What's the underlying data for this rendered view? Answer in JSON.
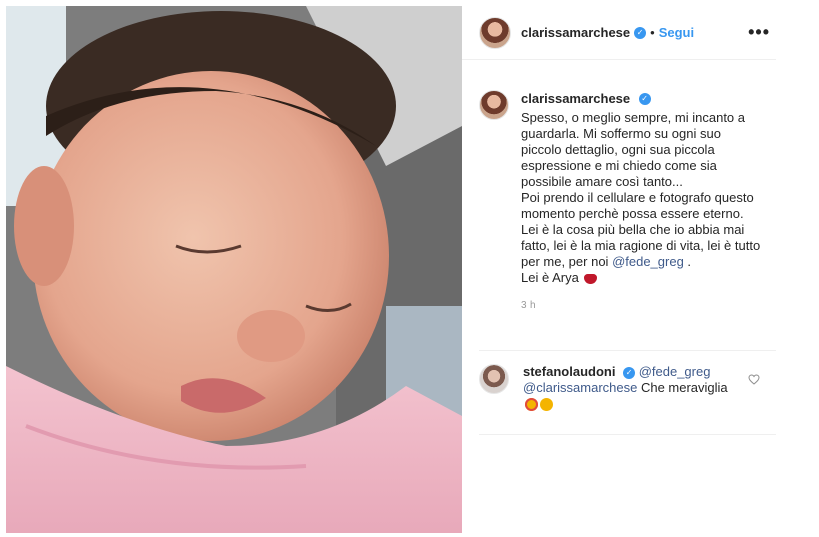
{
  "header": {
    "username": "clarissamarchese",
    "verified_mark": "✓",
    "separator": "•",
    "follow_label": "Segui",
    "more_label": "•••"
  },
  "caption": {
    "username": "clarissamarchese",
    "verified_mark": "✓",
    "text": "Spesso, o meglio sempre, mi incanto a guardarla. Mi soffermo su ogni suo piccolo dettaglio, ogni sua piccola espressione e mi chiedo come sia possibile amare così tanto...\nPoi prendo il cellulare e fotografo questo momento perchè possa essere eterno.\nLei è la cosa più bella che io abbia mai fatto, lei è la mia ragione di vita, lei è tutto per me, per noi",
    "mention": "@fede_greg",
    "text_after_mention": " .",
    "closing": "Lei è Arya",
    "emoji": "heart-emoji",
    "time": "3 h"
  },
  "comment": {
    "username": "stefanolaudoni",
    "verified_mark": "✓",
    "mention1": "@fede_greg",
    "mention2": "@clarissamarchese",
    "text": " Che meraviglia",
    "emojis": [
      "heart-eyes-emoji",
      "blush-emoji"
    ],
    "like_icon": "heart-outline-icon"
  },
  "colors": {
    "link_blue": "#3897f0",
    "mention": "#3f5a8a",
    "border": "#efefef"
  }
}
